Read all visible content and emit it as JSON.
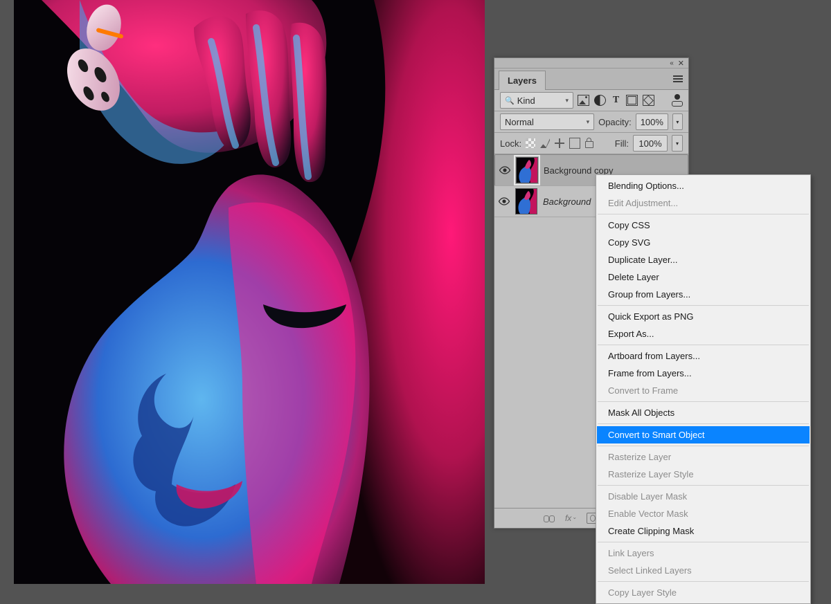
{
  "panel": {
    "title": "Layers",
    "collapse_glyph": "«",
    "close_glyph": "✕",
    "filter_label": "Kind",
    "filter_magnifier": "🔍",
    "type_glyph": "T",
    "blend_mode": "Normal",
    "opacity_label": "Opacity:",
    "opacity_value": "100%",
    "lock_label": "Lock:",
    "fill_label": "Fill:",
    "fill_value": "100%"
  },
  "layers": [
    {
      "name": "Background copy",
      "selected": true,
      "italic": false
    },
    {
      "name": "Background",
      "selected": false,
      "italic": true
    }
  ],
  "footer": {
    "fx_label": "fx"
  },
  "context_menu": {
    "groups": [
      [
        {
          "label": "Blending Options...",
          "enabled": true
        },
        {
          "label": "Edit Adjustment...",
          "enabled": false
        }
      ],
      [
        {
          "label": "Copy CSS",
          "enabled": true
        },
        {
          "label": "Copy SVG",
          "enabled": true
        },
        {
          "label": "Duplicate Layer...",
          "enabled": true
        },
        {
          "label": "Delete Layer",
          "enabled": true
        },
        {
          "label": "Group from Layers...",
          "enabled": true
        }
      ],
      [
        {
          "label": "Quick Export as PNG",
          "enabled": true
        },
        {
          "label": "Export As...",
          "enabled": true
        }
      ],
      [
        {
          "label": "Artboard from Layers...",
          "enabled": true
        },
        {
          "label": "Frame from Layers...",
          "enabled": true
        },
        {
          "label": "Convert to Frame",
          "enabled": false
        }
      ],
      [
        {
          "label": "Mask All Objects",
          "enabled": true
        }
      ],
      [
        {
          "label": "Convert to Smart Object",
          "enabled": true,
          "highlighted": true
        }
      ],
      [
        {
          "label": "Rasterize Layer",
          "enabled": false
        },
        {
          "label": "Rasterize Layer Style",
          "enabled": false
        }
      ],
      [
        {
          "label": "Disable Layer Mask",
          "enabled": false
        },
        {
          "label": "Enable Vector Mask",
          "enabled": false
        },
        {
          "label": "Create Clipping Mask",
          "enabled": true
        }
      ],
      [
        {
          "label": "Link Layers",
          "enabled": false
        },
        {
          "label": "Select Linked Layers",
          "enabled": false
        }
      ],
      [
        {
          "label": "Copy Layer Style",
          "enabled": false
        }
      ]
    ]
  }
}
